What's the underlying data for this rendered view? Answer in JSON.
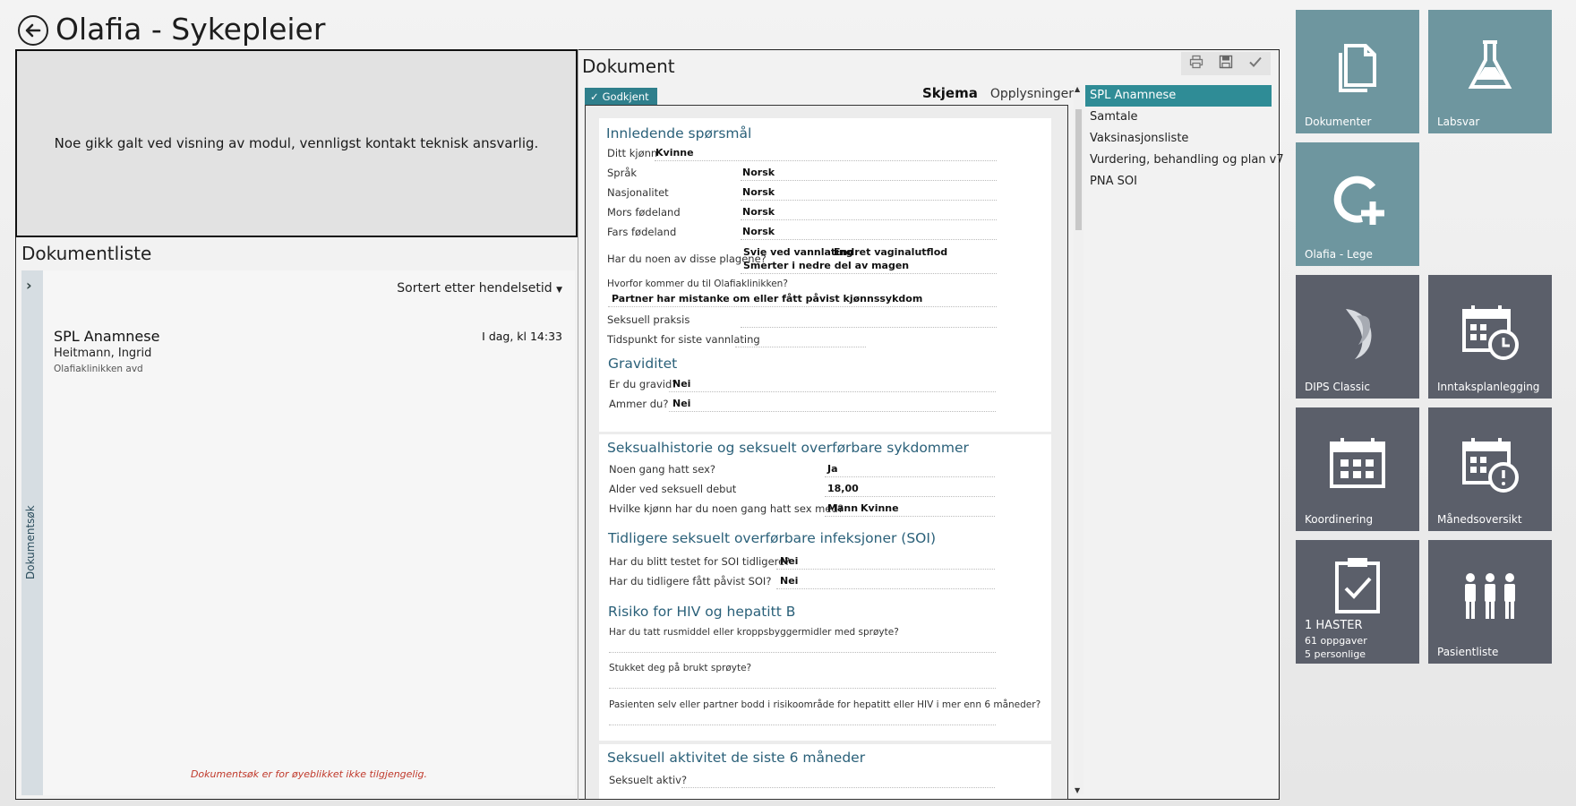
{
  "app": {
    "title": "Olafia - Sykepleier"
  },
  "error_panel": {
    "message": "Noe gikk galt ved visning av modul, vennligst kontakt teknisk ansvarlig."
  },
  "doclist": {
    "title": "Dokumentliste",
    "side_label": "Dokumentsøk",
    "sort_label": "Sortert etter hendelsetid",
    "items": [
      {
        "name": "SPL Anamnese",
        "time": "I dag, kl 14:33",
        "author": "Heitmann, Ingrid",
        "unit": "Olafiaklinikken avd"
      }
    ],
    "unavailable_message": "Dokumentsøk er for øyeblikket ikke tilgjengelig."
  },
  "document": {
    "title": "Dokument",
    "toolbar": {
      "print_icon": "printer-icon",
      "save_icon": "save-icon",
      "approve_icon": "check-icon"
    },
    "status_tag": "Godkjent",
    "tabs": {
      "skjema": "Skjema",
      "opplysninger": "Opplysninger"
    },
    "nav": [
      "SPL Anamnese",
      "Samtale",
      "Vaksinasjonsliste",
      "Vurdering, behandling og plan v7",
      "PNA SOI"
    ],
    "form": {
      "s1": {
        "title": "Innledende spørsmål",
        "kjonn_label": "Ditt kjønn",
        "kjonn_val": "Kvinne",
        "sprak_label": "Språk",
        "sprak_val": "Norsk",
        "nasj_label": "Nasjonalitet",
        "nasj_val": "Norsk",
        "mor_label": "Mors fødeland",
        "mor_val": "Norsk",
        "far_label": "Fars fødeland",
        "far_val": "Norsk",
        "plager_label": "Har du noen av disse plagene?",
        "plager_val1": "Svie ved vannlating",
        "plager_val2": "Endret vaginalutflod",
        "plager_val3": "Smerter i nedre del av magen",
        "hvorfor_label": "Hvorfor kommer du til Olafiaklinikken?",
        "hvorfor_val": "Partner har mistanke om eller fått påvist kjønnssykdom",
        "praksis_label": "Seksuell praksis",
        "tidspunkt_label": "Tidspunkt for siste vannlating",
        "grav_title": "Graviditet",
        "gravid_label": "Er du gravid?",
        "gravid_val": "Nei",
        "ammer_label": "Ammer du?",
        "ammer_val": "Nei"
      },
      "s2": {
        "title": "Seksualhistorie og seksuelt overførbare sykdommer",
        "sex_label": "Noen gang hatt sex?",
        "sex_val": "Ja",
        "alder_label": "Alder ved seksuell debut",
        "alder_val": "18,00",
        "kjonn_label": "Hvilke kjønn har du noen gang hatt sex med?",
        "kjonn_val1": "Mann",
        "kjonn_val2": "Kvinne",
        "soi_title": "Tidligere seksuelt overførbare infeksjoner (SOI)",
        "testet_label": "Har du blitt testet for SOI tidligere?",
        "testet_val": "Nei",
        "pavist_label": "Har du tidligere fått påvist SOI?",
        "pavist_val": "Nei",
        "hiv_title": "Risiko for HIV og hepatitt B",
        "rus_label": "Har du tatt rusmiddel eller kroppsbyggermidler med sprøyte?",
        "stukket_label": "Stukket deg på brukt sprøyte?",
        "bodd_label": "Pasienten selv eller partner bodd i risikoområde for hepatitt eller HIV i mer enn 6 måneder?"
      },
      "s3": {
        "title": "Seksuell aktivitet de siste 6 måneder",
        "aktiv_label": "Seksuelt aktiv?"
      }
    }
  },
  "tiles": [
    {
      "label": "Dokumenter",
      "icon": "documents-icon",
      "color": "#6e969f"
    },
    {
      "label": "Labsvar",
      "icon": "flask-icon",
      "color": "#6e969f"
    },
    {
      "label": "Olafia - Lege",
      "icon": "add-module-icon",
      "color": "#6e969f"
    },
    {
      "label": "DIPS Classic",
      "icon": "dips-logo-icon",
      "color": "#5b5f6a"
    },
    {
      "label": "Inntaksplanlegging",
      "icon": "calendar-clock-icon",
      "color": "#5b5f6a"
    },
    {
      "label": "Koordinering",
      "icon": "calendar-icon",
      "color": "#5b5f6a"
    },
    {
      "label": "Månedsoversikt",
      "icon": "calendar-alert-icon",
      "color": "#5b5f6a"
    },
    {
      "label": "1 HASTER",
      "sub1": "61 oppgaver",
      "sub2": "5 personlige",
      "icon": "clipboard-check-icon",
      "color": "#5b5f6a"
    },
    {
      "label": "Pasientliste",
      "icon": "people-icon",
      "color": "#5b5f6a"
    }
  ]
}
